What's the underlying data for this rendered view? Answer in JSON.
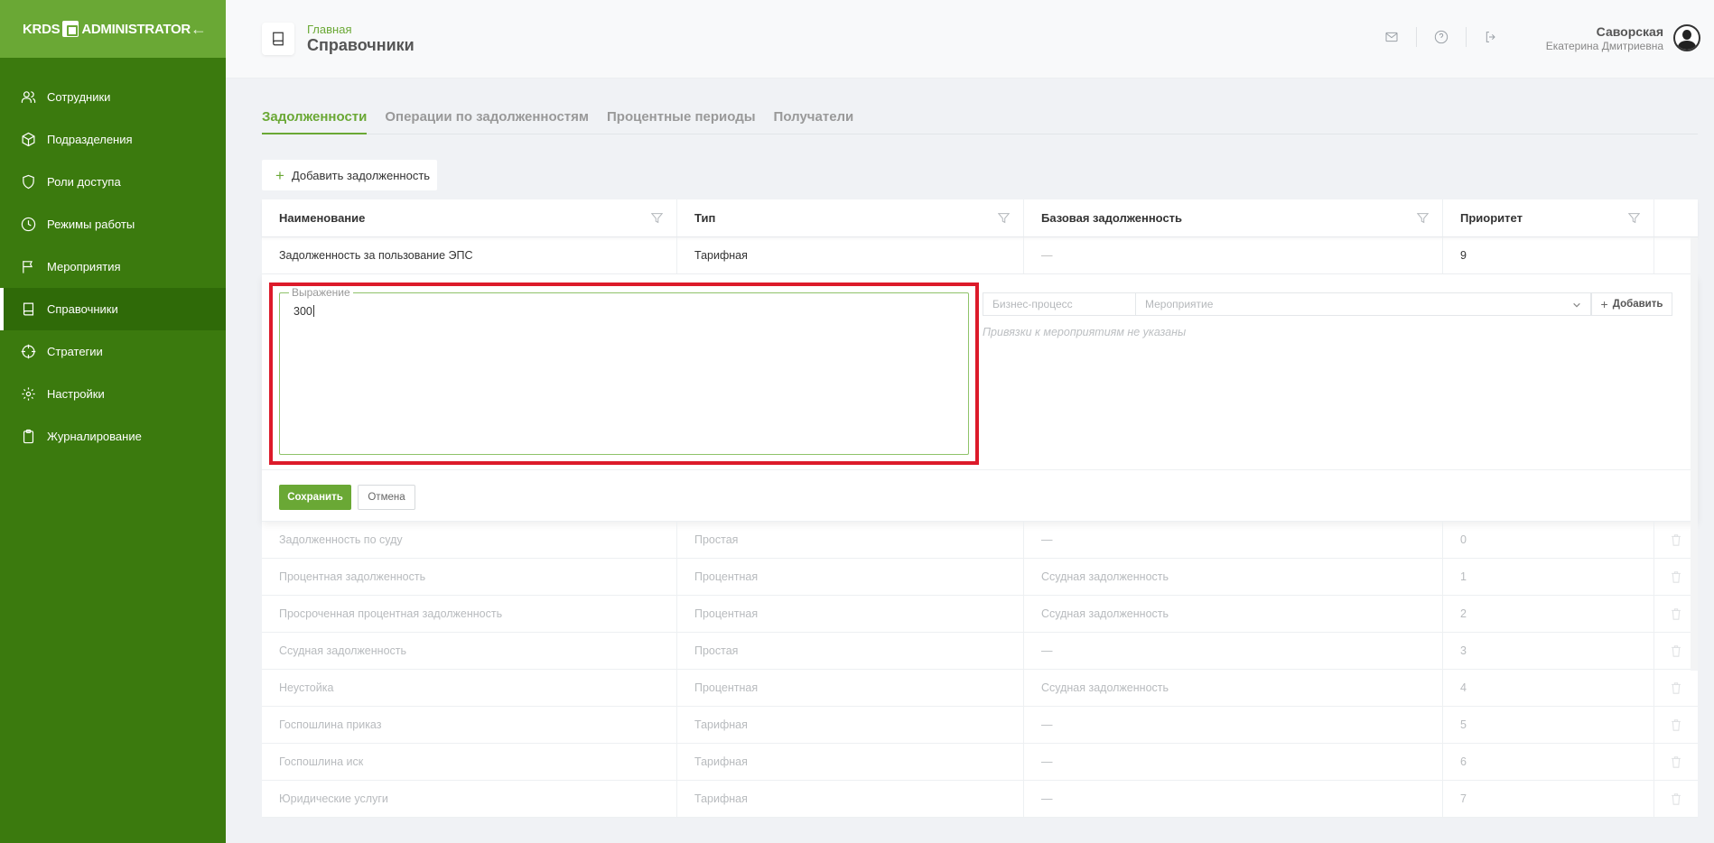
{
  "sidebar": {
    "logo_left": "KRDS",
    "logo_right": "ADMINISTRATOR",
    "items": [
      {
        "label": "Сотрудники"
      },
      {
        "label": "Подразделения"
      },
      {
        "label": "Роли доступа"
      },
      {
        "label": "Режимы работы"
      },
      {
        "label": "Мероприятия"
      },
      {
        "label": "Справочники"
      },
      {
        "label": "Стратегии"
      },
      {
        "label": "Настройки"
      },
      {
        "label": "Журналирование"
      }
    ],
    "active_index": 5
  },
  "header": {
    "breadcrumb": "Главная",
    "title": "Справочники",
    "user_last_name": "Саворская",
    "user_first_middle": "Екатерина Дмитриевна"
  },
  "tabs": [
    {
      "label": "Задолженности",
      "active": true
    },
    {
      "label": "Операции по задолженностям",
      "active": false
    },
    {
      "label": "Процентные периоды",
      "active": false
    },
    {
      "label": "Получатели",
      "active": false
    }
  ],
  "add_button": {
    "label": "Добавить задолженность"
  },
  "table": {
    "columns": [
      "Наименование",
      "Тип",
      "Базовая задолженность",
      "Приоритет"
    ],
    "first_row": {
      "name": "Задолженность за пользование ЭПС",
      "type": "Тарифная",
      "base": "—",
      "priority": "9"
    },
    "rows": [
      {
        "name": "Задолженность по суду",
        "type": "Простая",
        "base": "—",
        "priority": "0"
      },
      {
        "name": "Процентная задолженность",
        "type": "Процентная",
        "base": "Ссудная задолженность",
        "priority": "1"
      },
      {
        "name": "Просроченная процентная задолженность",
        "type": "Процентная",
        "base": "Ссудная задолженность",
        "priority": "2"
      },
      {
        "name": "Ссудная задолженность",
        "type": "Простая",
        "base": "—",
        "priority": "3"
      },
      {
        "name": "Неустойка",
        "type": "Процентная",
        "base": "Ссудная задолженность",
        "priority": "4"
      },
      {
        "name": "Госпошлина приказ",
        "type": "Тарифная",
        "base": "—",
        "priority": "5"
      },
      {
        "name": "Госпошлина иск",
        "type": "Тарифная",
        "base": "—",
        "priority": "6"
      },
      {
        "name": "Юридические услуги",
        "type": "Тарифная",
        "base": "—",
        "priority": "7"
      }
    ]
  },
  "edit_form": {
    "expression_label": "Выражение",
    "expression_value": "300",
    "business_process_placeholder": "Бизнес-процесс",
    "event_placeholder": "Мероприятие",
    "add_label": "Добавить",
    "no_bindings_text": "Привязки к мероприятиям не указаны",
    "save_label": "Сохранить",
    "cancel_label": "Отмена"
  },
  "colors": {
    "brand_green": "#6aa835",
    "sidebar_green": "#3b7a0e",
    "highlight_red": "#dc1a2a"
  }
}
